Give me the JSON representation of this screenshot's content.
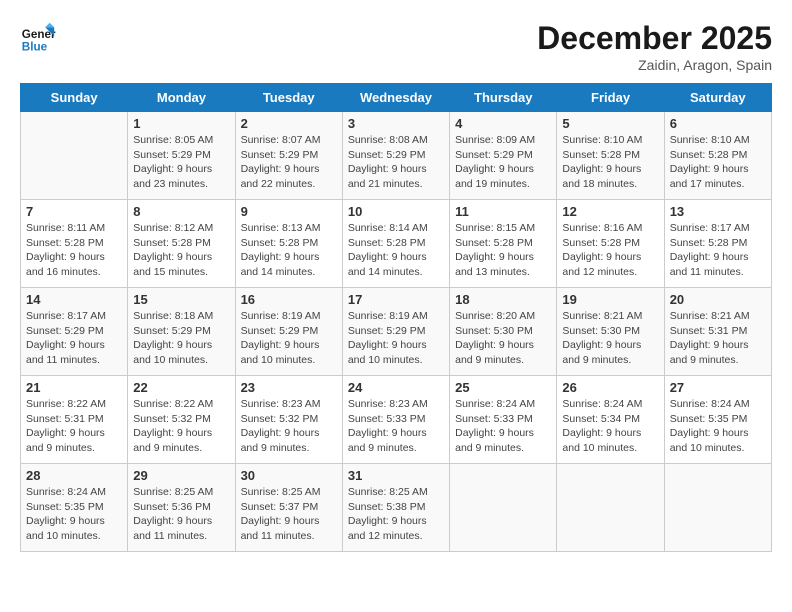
{
  "logo": {
    "line1": "General",
    "line2": "Blue"
  },
  "title": "December 2025",
  "location": "Zaidin, Aragon, Spain",
  "days_of_week": [
    "Sunday",
    "Monday",
    "Tuesday",
    "Wednesday",
    "Thursday",
    "Friday",
    "Saturday"
  ],
  "weeks": [
    [
      {
        "day": "",
        "info": ""
      },
      {
        "day": "1",
        "info": "Sunrise: 8:05 AM\nSunset: 5:29 PM\nDaylight: 9 hours\nand 23 minutes."
      },
      {
        "day": "2",
        "info": "Sunrise: 8:07 AM\nSunset: 5:29 PM\nDaylight: 9 hours\nand 22 minutes."
      },
      {
        "day": "3",
        "info": "Sunrise: 8:08 AM\nSunset: 5:29 PM\nDaylight: 9 hours\nand 21 minutes."
      },
      {
        "day": "4",
        "info": "Sunrise: 8:09 AM\nSunset: 5:29 PM\nDaylight: 9 hours\nand 19 minutes."
      },
      {
        "day": "5",
        "info": "Sunrise: 8:10 AM\nSunset: 5:28 PM\nDaylight: 9 hours\nand 18 minutes."
      },
      {
        "day": "6",
        "info": "Sunrise: 8:10 AM\nSunset: 5:28 PM\nDaylight: 9 hours\nand 17 minutes."
      }
    ],
    [
      {
        "day": "7",
        "info": "Sunrise: 8:11 AM\nSunset: 5:28 PM\nDaylight: 9 hours\nand 16 minutes."
      },
      {
        "day": "8",
        "info": "Sunrise: 8:12 AM\nSunset: 5:28 PM\nDaylight: 9 hours\nand 15 minutes."
      },
      {
        "day": "9",
        "info": "Sunrise: 8:13 AM\nSunset: 5:28 PM\nDaylight: 9 hours\nand 14 minutes."
      },
      {
        "day": "10",
        "info": "Sunrise: 8:14 AM\nSunset: 5:28 PM\nDaylight: 9 hours\nand 14 minutes."
      },
      {
        "day": "11",
        "info": "Sunrise: 8:15 AM\nSunset: 5:28 PM\nDaylight: 9 hours\nand 13 minutes."
      },
      {
        "day": "12",
        "info": "Sunrise: 8:16 AM\nSunset: 5:28 PM\nDaylight: 9 hours\nand 12 minutes."
      },
      {
        "day": "13",
        "info": "Sunrise: 8:17 AM\nSunset: 5:28 PM\nDaylight: 9 hours\nand 11 minutes."
      }
    ],
    [
      {
        "day": "14",
        "info": "Sunrise: 8:17 AM\nSunset: 5:29 PM\nDaylight: 9 hours\nand 11 minutes."
      },
      {
        "day": "15",
        "info": "Sunrise: 8:18 AM\nSunset: 5:29 PM\nDaylight: 9 hours\nand 10 minutes."
      },
      {
        "day": "16",
        "info": "Sunrise: 8:19 AM\nSunset: 5:29 PM\nDaylight: 9 hours\nand 10 minutes."
      },
      {
        "day": "17",
        "info": "Sunrise: 8:19 AM\nSunset: 5:29 PM\nDaylight: 9 hours\nand 10 minutes."
      },
      {
        "day": "18",
        "info": "Sunrise: 8:20 AM\nSunset: 5:30 PM\nDaylight: 9 hours\nand 9 minutes."
      },
      {
        "day": "19",
        "info": "Sunrise: 8:21 AM\nSunset: 5:30 PM\nDaylight: 9 hours\nand 9 minutes."
      },
      {
        "day": "20",
        "info": "Sunrise: 8:21 AM\nSunset: 5:31 PM\nDaylight: 9 hours\nand 9 minutes."
      }
    ],
    [
      {
        "day": "21",
        "info": "Sunrise: 8:22 AM\nSunset: 5:31 PM\nDaylight: 9 hours\nand 9 minutes."
      },
      {
        "day": "22",
        "info": "Sunrise: 8:22 AM\nSunset: 5:32 PM\nDaylight: 9 hours\nand 9 minutes."
      },
      {
        "day": "23",
        "info": "Sunrise: 8:23 AM\nSunset: 5:32 PM\nDaylight: 9 hours\nand 9 minutes."
      },
      {
        "day": "24",
        "info": "Sunrise: 8:23 AM\nSunset: 5:33 PM\nDaylight: 9 hours\nand 9 minutes."
      },
      {
        "day": "25",
        "info": "Sunrise: 8:24 AM\nSunset: 5:33 PM\nDaylight: 9 hours\nand 9 minutes."
      },
      {
        "day": "26",
        "info": "Sunrise: 8:24 AM\nSunset: 5:34 PM\nDaylight: 9 hours\nand 10 minutes."
      },
      {
        "day": "27",
        "info": "Sunrise: 8:24 AM\nSunset: 5:35 PM\nDaylight: 9 hours\nand 10 minutes."
      }
    ],
    [
      {
        "day": "28",
        "info": "Sunrise: 8:24 AM\nSunset: 5:35 PM\nDaylight: 9 hours\nand 10 minutes."
      },
      {
        "day": "29",
        "info": "Sunrise: 8:25 AM\nSunset: 5:36 PM\nDaylight: 9 hours\nand 11 minutes."
      },
      {
        "day": "30",
        "info": "Sunrise: 8:25 AM\nSunset: 5:37 PM\nDaylight: 9 hours\nand 11 minutes."
      },
      {
        "day": "31",
        "info": "Sunrise: 8:25 AM\nSunset: 5:38 PM\nDaylight: 9 hours\nand 12 minutes."
      },
      {
        "day": "",
        "info": ""
      },
      {
        "day": "",
        "info": ""
      },
      {
        "day": "",
        "info": ""
      }
    ]
  ]
}
